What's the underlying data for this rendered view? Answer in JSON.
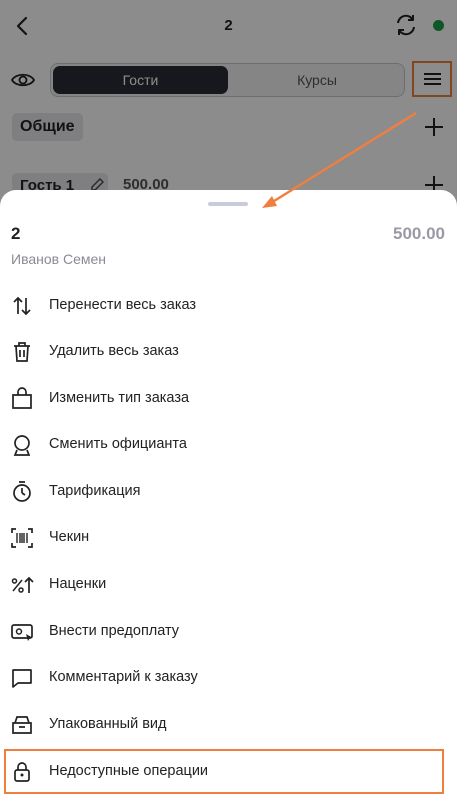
{
  "header": {
    "order_number": "2",
    "tabs": [
      "Гости",
      "Курсы"
    ],
    "status_color": "#1f9d4a"
  },
  "order": {
    "section_label": "Общие",
    "guest_label": "Гость 1",
    "guest_sum": "500.00"
  },
  "sheet": {
    "title": "2",
    "total": "500.00",
    "waiter": "Иванов Семен",
    "actions": [
      {
        "label": "Перенести весь заказ",
        "icon": "swap-vertical-icon"
      },
      {
        "label": "Удалить весь заказ",
        "icon": "trash-icon"
      },
      {
        "label": "Изменить тип заказа",
        "icon": "bag-icon"
      },
      {
        "label": "Сменить официанта",
        "icon": "waiter-icon"
      },
      {
        "label": "Тарификация",
        "icon": "stopwatch-icon"
      },
      {
        "label": "Чекин",
        "icon": "barcode-scan-icon"
      },
      {
        "label": "Наценки",
        "icon": "percent-up-icon"
      },
      {
        "label": "Внести предоплату",
        "icon": "prepay-icon"
      },
      {
        "label": "Комментарий к заказу",
        "icon": "comment-icon"
      },
      {
        "label": "Упакованный вид",
        "icon": "package-icon"
      },
      {
        "label": "Недоступные операции",
        "icon": "lock-icon"
      }
    ]
  },
  "accent_color": "#ef7f3f"
}
